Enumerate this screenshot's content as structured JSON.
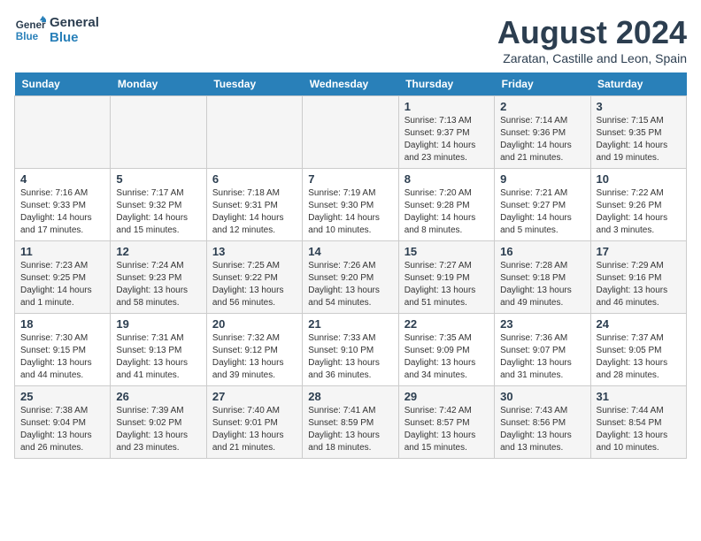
{
  "header": {
    "logo_line1": "General",
    "logo_line2": "Blue",
    "month_year": "August 2024",
    "location": "Zaratan, Castille and Leon, Spain"
  },
  "weekdays": [
    "Sunday",
    "Monday",
    "Tuesday",
    "Wednesday",
    "Thursday",
    "Friday",
    "Saturday"
  ],
  "weeks": [
    [
      {
        "day": "",
        "info": ""
      },
      {
        "day": "",
        "info": ""
      },
      {
        "day": "",
        "info": ""
      },
      {
        "day": "",
        "info": ""
      },
      {
        "day": "1",
        "info": "Sunrise: 7:13 AM\nSunset: 9:37 PM\nDaylight: 14 hours\nand 23 minutes."
      },
      {
        "day": "2",
        "info": "Sunrise: 7:14 AM\nSunset: 9:36 PM\nDaylight: 14 hours\nand 21 minutes."
      },
      {
        "day": "3",
        "info": "Sunrise: 7:15 AM\nSunset: 9:35 PM\nDaylight: 14 hours\nand 19 minutes."
      }
    ],
    [
      {
        "day": "4",
        "info": "Sunrise: 7:16 AM\nSunset: 9:33 PM\nDaylight: 14 hours\nand 17 minutes."
      },
      {
        "day": "5",
        "info": "Sunrise: 7:17 AM\nSunset: 9:32 PM\nDaylight: 14 hours\nand 15 minutes."
      },
      {
        "day": "6",
        "info": "Sunrise: 7:18 AM\nSunset: 9:31 PM\nDaylight: 14 hours\nand 12 minutes."
      },
      {
        "day": "7",
        "info": "Sunrise: 7:19 AM\nSunset: 9:30 PM\nDaylight: 14 hours\nand 10 minutes."
      },
      {
        "day": "8",
        "info": "Sunrise: 7:20 AM\nSunset: 9:28 PM\nDaylight: 14 hours\nand 8 minutes."
      },
      {
        "day": "9",
        "info": "Sunrise: 7:21 AM\nSunset: 9:27 PM\nDaylight: 14 hours\nand 5 minutes."
      },
      {
        "day": "10",
        "info": "Sunrise: 7:22 AM\nSunset: 9:26 PM\nDaylight: 14 hours\nand 3 minutes."
      }
    ],
    [
      {
        "day": "11",
        "info": "Sunrise: 7:23 AM\nSunset: 9:25 PM\nDaylight: 14 hours\nand 1 minute."
      },
      {
        "day": "12",
        "info": "Sunrise: 7:24 AM\nSunset: 9:23 PM\nDaylight: 13 hours\nand 58 minutes."
      },
      {
        "day": "13",
        "info": "Sunrise: 7:25 AM\nSunset: 9:22 PM\nDaylight: 13 hours\nand 56 minutes."
      },
      {
        "day": "14",
        "info": "Sunrise: 7:26 AM\nSunset: 9:20 PM\nDaylight: 13 hours\nand 54 minutes."
      },
      {
        "day": "15",
        "info": "Sunrise: 7:27 AM\nSunset: 9:19 PM\nDaylight: 13 hours\nand 51 minutes."
      },
      {
        "day": "16",
        "info": "Sunrise: 7:28 AM\nSunset: 9:18 PM\nDaylight: 13 hours\nand 49 minutes."
      },
      {
        "day": "17",
        "info": "Sunrise: 7:29 AM\nSunset: 9:16 PM\nDaylight: 13 hours\nand 46 minutes."
      }
    ],
    [
      {
        "day": "18",
        "info": "Sunrise: 7:30 AM\nSunset: 9:15 PM\nDaylight: 13 hours\nand 44 minutes."
      },
      {
        "day": "19",
        "info": "Sunrise: 7:31 AM\nSunset: 9:13 PM\nDaylight: 13 hours\nand 41 minutes."
      },
      {
        "day": "20",
        "info": "Sunrise: 7:32 AM\nSunset: 9:12 PM\nDaylight: 13 hours\nand 39 minutes."
      },
      {
        "day": "21",
        "info": "Sunrise: 7:33 AM\nSunset: 9:10 PM\nDaylight: 13 hours\nand 36 minutes."
      },
      {
        "day": "22",
        "info": "Sunrise: 7:35 AM\nSunset: 9:09 PM\nDaylight: 13 hours\nand 34 minutes."
      },
      {
        "day": "23",
        "info": "Sunrise: 7:36 AM\nSunset: 9:07 PM\nDaylight: 13 hours\nand 31 minutes."
      },
      {
        "day": "24",
        "info": "Sunrise: 7:37 AM\nSunset: 9:05 PM\nDaylight: 13 hours\nand 28 minutes."
      }
    ],
    [
      {
        "day": "25",
        "info": "Sunrise: 7:38 AM\nSunset: 9:04 PM\nDaylight: 13 hours\nand 26 minutes."
      },
      {
        "day": "26",
        "info": "Sunrise: 7:39 AM\nSunset: 9:02 PM\nDaylight: 13 hours\nand 23 minutes."
      },
      {
        "day": "27",
        "info": "Sunrise: 7:40 AM\nSunset: 9:01 PM\nDaylight: 13 hours\nand 21 minutes."
      },
      {
        "day": "28",
        "info": "Sunrise: 7:41 AM\nSunset: 8:59 PM\nDaylight: 13 hours\nand 18 minutes."
      },
      {
        "day": "29",
        "info": "Sunrise: 7:42 AM\nSunset: 8:57 PM\nDaylight: 13 hours\nand 15 minutes."
      },
      {
        "day": "30",
        "info": "Sunrise: 7:43 AM\nSunset: 8:56 PM\nDaylight: 13 hours\nand 13 minutes."
      },
      {
        "day": "31",
        "info": "Sunrise: 7:44 AM\nSunset: 8:54 PM\nDaylight: 13 hours\nand 10 minutes."
      }
    ]
  ]
}
